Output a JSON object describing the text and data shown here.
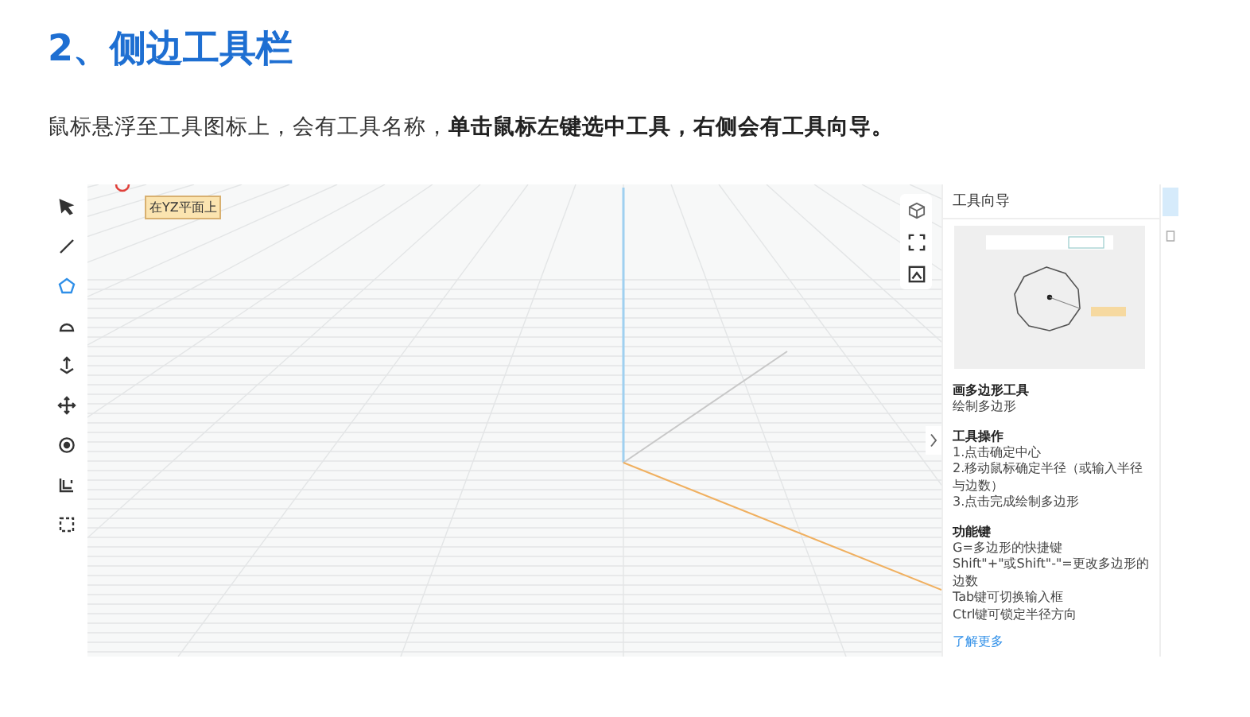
{
  "heading": "2、侧边工具栏",
  "intro": "鼠标悬浮至工具图标上，会有工具名称，**单击鼠标左键选中工具，右侧会有工具向导。**",
  "toolbar": [
    {
      "kind": "select",
      "selected": false
    },
    {
      "kind": "line",
      "selected": false
    },
    {
      "kind": "polygon",
      "selected": true
    },
    {
      "kind": "arc",
      "selected": false
    },
    {
      "kind": "push",
      "selected": false
    },
    {
      "kind": "move",
      "selected": false
    },
    {
      "kind": "rotate",
      "selected": false
    },
    {
      "kind": "offset",
      "selected": false
    },
    {
      "kind": "frame",
      "selected": false
    }
  ],
  "canvas": {
    "tooltip": "在YZ平面上"
  },
  "guide": {
    "title": "工具向导",
    "tool_name": "画多边形工具",
    "tool_desc": "绘制多边形",
    "sections": [
      {
        "title": "工具操作",
        "lines": [
          "1.点击确定中心",
          "2.移动鼠标确定半径（或输入半径与边数）",
          "3.点击完成绘制多边形"
        ]
      },
      {
        "title": "功能键",
        "lines": [
          "G=多边形的快捷键",
          "Shift\"+\"或Shift\"-\"=更改多边形的边数",
          "Tab键可切换输入框",
          "Ctrl键可锁定半径方向"
        ]
      }
    ],
    "link": "了解更多"
  }
}
